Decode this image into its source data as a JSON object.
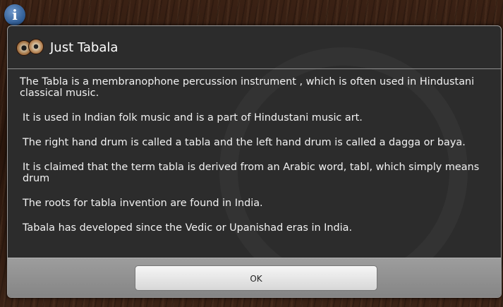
{
  "app": {
    "info_icon": "info-icon",
    "info_glyph": "i"
  },
  "dialog": {
    "title": "Just Tabala",
    "app_icon": "tabla-drums-icon",
    "paragraphs": [
      "The Tabla is a membranophone percussion instrument , which is often used in Hindustani classical music.",
      "It is used in Indian folk music and is a part of Hindustani music art.",
      "The right hand drum is called a tabla and the left hand drum is called a dagga or baya.",
      "It is claimed that the term tabla is derived from an Arabic word, tabl, which simply means drum",
      "The roots for tabla invention are found in India.",
      "Tabala has developed since the Vedic or Upanishad eras in India."
    ],
    "ok_label": "OK"
  },
  "colors": {
    "dialog_background": "#2c2c2c",
    "button_bar": "#8f8f8f",
    "text": "#f2f2f2"
  }
}
